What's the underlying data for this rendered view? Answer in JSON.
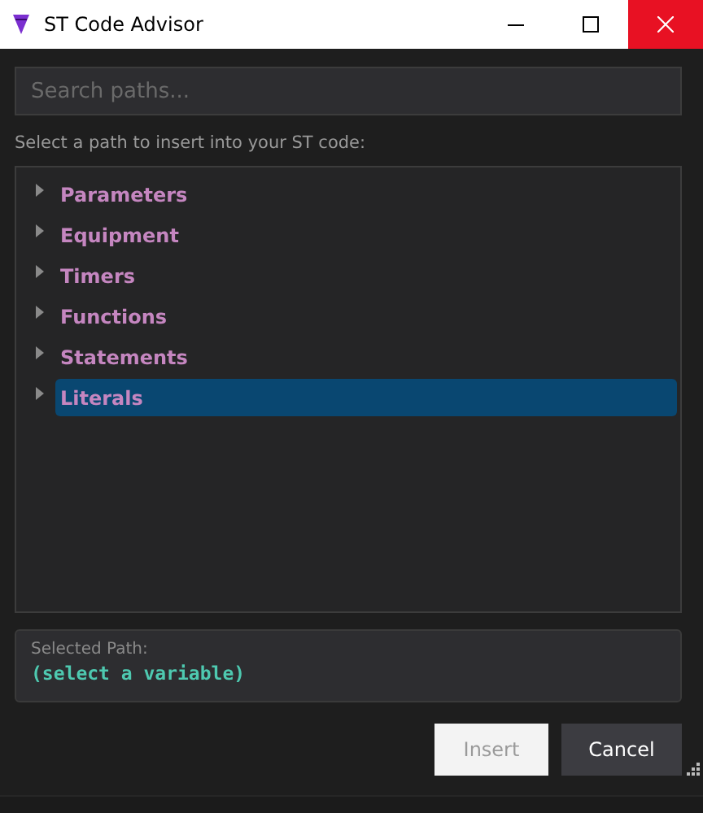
{
  "window": {
    "title": "ST Code Advisor"
  },
  "search": {
    "placeholder": "Search paths..."
  },
  "instruction": "Select a path to insert into your ST code:",
  "tree": {
    "items": [
      {
        "label": "Parameters",
        "expanded": false,
        "selected": false
      },
      {
        "label": "Equipment",
        "expanded": false,
        "selected": false
      },
      {
        "label": "Timers",
        "expanded": false,
        "selected": false
      },
      {
        "label": "Functions",
        "expanded": false,
        "selected": false
      },
      {
        "label": "Statements",
        "expanded": false,
        "selected": false
      },
      {
        "label": "Literals",
        "expanded": false,
        "selected": true
      }
    ]
  },
  "selected_path": {
    "label": "Selected Path:",
    "value": "(select a variable)"
  },
  "buttons": [
    {
      "label": "Insert",
      "disabled": true
    },
    {
      "label": "Cancel",
      "disabled": false
    }
  ]
}
